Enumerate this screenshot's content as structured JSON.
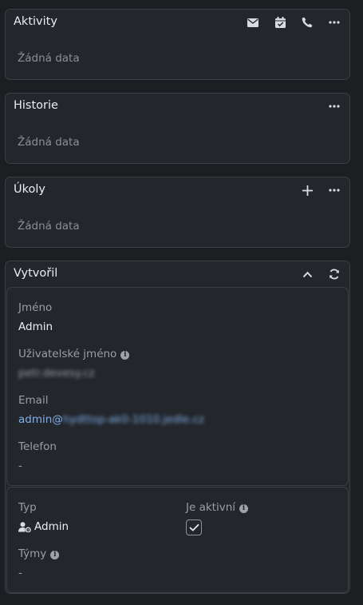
{
  "activities": {
    "title": "Aktivity",
    "empty": "Žádná data",
    "icons": [
      "envelope-icon",
      "calendar-check-icon",
      "phone-icon",
      "ellipsis-icon"
    ]
  },
  "history": {
    "title": "Historie",
    "empty": "Žádná data",
    "icons": [
      "ellipsis-icon"
    ]
  },
  "tasks": {
    "title": "Úkoly",
    "empty": "Žádná data",
    "icons": [
      "plus-icon",
      "ellipsis-icon"
    ]
  },
  "created_by": {
    "title": "Vytvořil",
    "icons": [
      "chevron-up-icon",
      "refresh-icon"
    ],
    "name_label": "Jméno",
    "name_value": "Admin",
    "username_label": "Uživatelské jméno",
    "username_value": "petr.devesy.cz",
    "email_label": "Email",
    "email_prefix": "admin@",
    "email_rest": "hydttop-ak0-1010.jedle.cz",
    "phone_label": "Telefon",
    "phone_value": "-",
    "type_label": "Typ",
    "type_value": "Admin",
    "active_label": "Je aktivní",
    "active_checked": true,
    "teams_label": "Týmy",
    "teams_value": "-"
  }
}
